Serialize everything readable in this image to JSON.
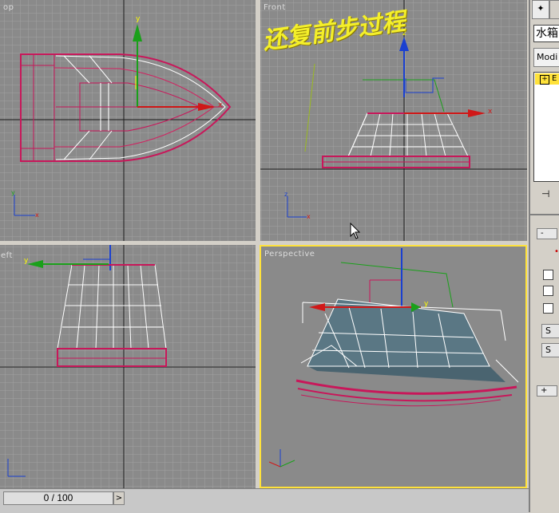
{
  "viewports": {
    "top": {
      "label": "op"
    },
    "front": {
      "label": "Front"
    },
    "left": {
      "label": "eft"
    },
    "perspective": {
      "label": "Perspective"
    }
  },
  "annotation": "还复前步过程",
  "panel": {
    "object_name": "水箱",
    "modifier_list": "Modi",
    "stack_item": "E",
    "stack_expand": "+",
    "pin_icon": "pin-icon",
    "rollout_toggle": "-",
    "rollout_dot": "•",
    "btn1": "S",
    "btn2": "S",
    "rollout_plus": "+"
  },
  "timeline": {
    "frame": "0 / 100",
    "next": ">"
  },
  "colors": {
    "grid_bg": "#8a8a8a",
    "active_border": "#ffe23a",
    "selection": "#c8175a",
    "wire": "#ffffff",
    "annotation": "#f4ef2a"
  }
}
